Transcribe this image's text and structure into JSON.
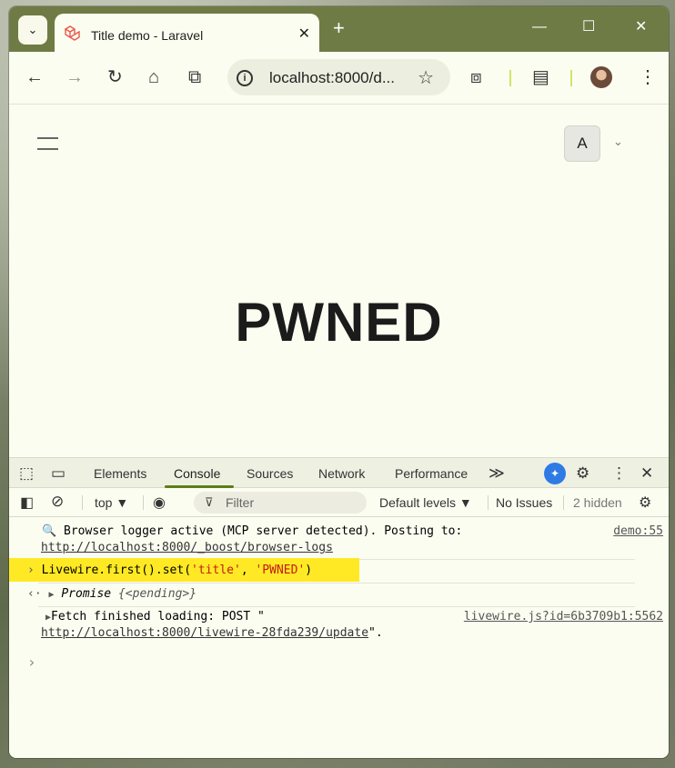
{
  "browser": {
    "tab_title": "Title demo - Laravel",
    "tab_close": "✕",
    "new_tab": "+",
    "url": "localhost:8000/d...",
    "window_controls": {
      "minimize": "—",
      "maximize": "☐",
      "close": "✕"
    }
  },
  "toolbar": {
    "back": "←",
    "forward": "→",
    "reload": "↻",
    "home": "⌂",
    "split": "⧉",
    "star": "☆",
    "extensions": "⧈",
    "reading_list": "▤",
    "menu": "⋮"
  },
  "page": {
    "user_initial": "A",
    "user_chevron": "⌄",
    "headline": "PWNED"
  },
  "devtools": {
    "tabs": [
      "Elements",
      "Console",
      "Sources",
      "Network",
      "Performance"
    ],
    "more_tabs": "≫",
    "active_tab": "Console",
    "close": "✕",
    "settings": "⚙",
    "kebab": "⋮",
    "filterbar": {
      "context": "top ▼",
      "filter_placeholder": "Filter",
      "levels": "Default levels ▼",
      "issues": "No Issues",
      "hidden": "2 hidden"
    },
    "console": {
      "log1_text": "Browser logger active (MCP server detected). Posting to:",
      "log1_link": "http://localhost:8000/_boost/browser-logs",
      "log1_source": "demo:55",
      "input_prefix": "Livewire.first().set(",
      "input_arg1": "'title'",
      "input_sep": ", ",
      "input_arg2": "'PWNED'",
      "input_suffix": ")",
      "result_label": "Promise",
      "result_state": "{<pending>}",
      "fetch_text": "Fetch finished loading: POST \"",
      "fetch_link": "http://localhost:8000/livewire-28fda239/update",
      "fetch_end": "\".",
      "fetch_source": "livewire.js?id=6b3709b1:5562",
      "prompt": "›"
    }
  }
}
